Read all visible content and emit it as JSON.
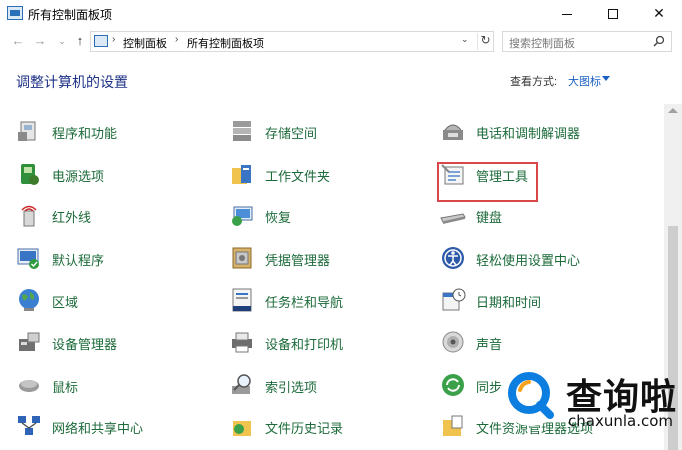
{
  "window": {
    "title": "所有控制面板项",
    "buttons": {
      "minimize": "minimize",
      "maximize": "maximize",
      "close": "✕"
    }
  },
  "address_bar": {
    "breadcrumbs": [
      "控制面板",
      "所有控制面板项"
    ],
    "separator": "›"
  },
  "search": {
    "placeholder": "搜索控制面板"
  },
  "header": {
    "title": "调整计算机的设置",
    "view_label": "查看方式:",
    "view_value": "大图标"
  },
  "columns": [
    [
      {
        "label": "程序和功能",
        "icon": "programs-icon"
      },
      {
        "label": "电源选项",
        "icon": "power-options-icon"
      },
      {
        "label": "红外线",
        "icon": "infrared-icon"
      },
      {
        "label": "默认程序",
        "icon": "default-programs-icon"
      },
      {
        "label": "区域",
        "icon": "region-icon"
      },
      {
        "label": "设备管理器",
        "icon": "device-manager-icon"
      },
      {
        "label": "鼠标",
        "icon": "mouse-icon"
      },
      {
        "label": "网络和共享中心",
        "icon": "network-icon"
      }
    ],
    [
      {
        "label": "存储空间",
        "icon": "storage-icon"
      },
      {
        "label": "工作文件夹",
        "icon": "work-folders-icon"
      },
      {
        "label": "恢复",
        "icon": "recovery-icon"
      },
      {
        "label": "凭据管理器",
        "icon": "credential-manager-icon"
      },
      {
        "label": "任务栏和导航",
        "icon": "taskbar-icon"
      },
      {
        "label": "设备和打印机",
        "icon": "printer-icon"
      },
      {
        "label": "索引选项",
        "icon": "indexing-icon"
      },
      {
        "label": "文件历史记录",
        "icon": "file-history-icon"
      }
    ],
    [
      {
        "label": "电话和调制解调器",
        "icon": "phone-modem-icon"
      },
      {
        "label": "管理工具",
        "icon": "admin-tools-icon"
      },
      {
        "label": "键盘",
        "icon": "keyboard-icon"
      },
      {
        "label": "轻松使用设置中心",
        "icon": "ease-of-access-icon"
      },
      {
        "label": "日期和时间",
        "icon": "date-time-icon"
      },
      {
        "label": "声音",
        "icon": "sound-icon"
      },
      {
        "label": "同步",
        "icon": "sync-center-icon"
      },
      {
        "label": "文件资源管理器选项",
        "icon": "explorer-options-icon"
      }
    ]
  ],
  "highlighted_item": "管理工具",
  "watermark": {
    "text": "查询啦",
    "url": "chaxunla.com"
  },
  "colors": {
    "link": "#1c6a3a",
    "title": "#1e3287",
    "accent": "#1a5fc2",
    "highlight": "#d9474b",
    "watermark": "#0b7ee0"
  }
}
